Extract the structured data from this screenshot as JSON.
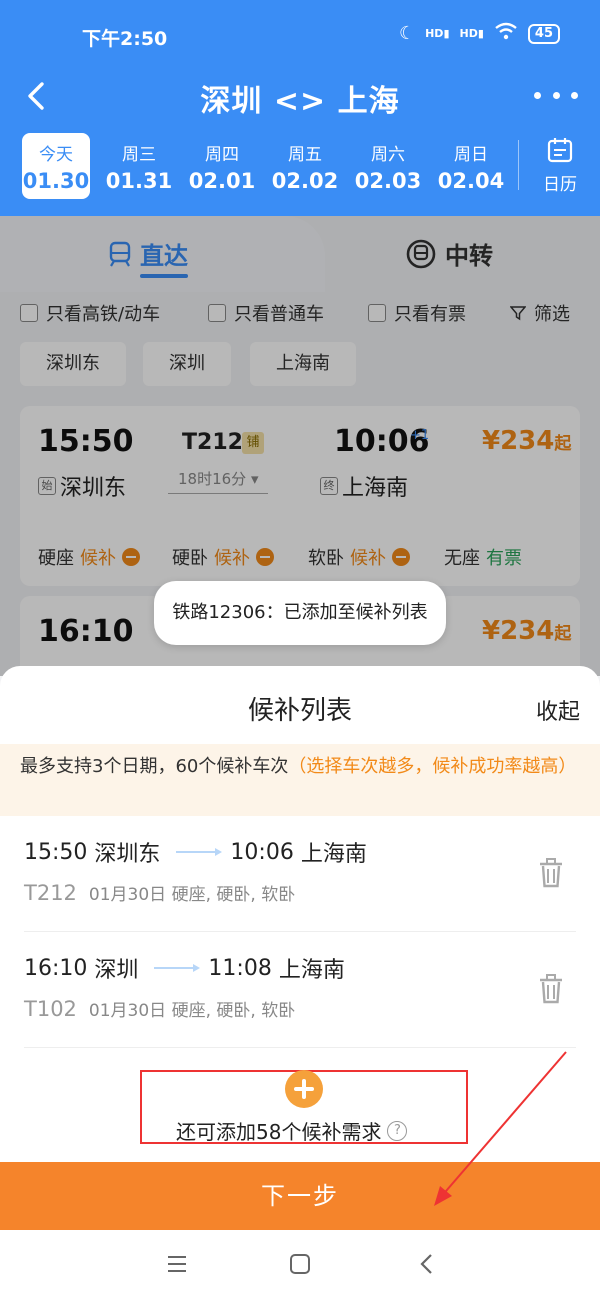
{
  "status_bar": {
    "time": "下午2:50",
    "signal1": "HD",
    "signal2": "HD",
    "battery": "45"
  },
  "header": {
    "title": "深圳 <> 上海"
  },
  "dates": [
    {
      "week": "今天",
      "date": "01.30",
      "active": true
    },
    {
      "week": "周三",
      "date": "01.31"
    },
    {
      "week": "周四",
      "date": "02.01"
    },
    {
      "week": "周五",
      "date": "02.02"
    },
    {
      "week": "周六",
      "date": "02.03"
    },
    {
      "week": "周日",
      "date": "02.04"
    }
  ],
  "calendar_label": "日历",
  "tabs": {
    "direct": "直达",
    "transfer": "中转"
  },
  "filters": {
    "gd": "只看高铁/动车",
    "normal": "只看普通车",
    "available": "只看有票",
    "screen": "筛选"
  },
  "stations": [
    "深圳东",
    "深圳",
    "上海南"
  ],
  "trains": [
    {
      "depart": "15:50",
      "depart_tag": "始",
      "from": "深圳东",
      "code": "T212",
      "badge": "铺",
      "duration": "18时16分 ▾",
      "arrive": "10:06",
      "plus_day": "+1",
      "arrive_tag": "终",
      "to": "上海南",
      "price": "¥234",
      "price_suffix": "起",
      "seats": [
        {
          "type": "硬座",
          "status": "候补"
        },
        {
          "type": "硬卧",
          "status": "候补"
        },
        {
          "type": "软卧",
          "status": "候补"
        },
        {
          "type": "无座",
          "status": "有票"
        }
      ]
    },
    {
      "depart": "16:10",
      "price": "¥234",
      "price_suffix": "起"
    }
  ],
  "toast": "铁路12306：已添加至候补列表",
  "sheet": {
    "title": "候补列表",
    "collapse": "收起",
    "notice_main": "最多支持3个日期，60个候补车次",
    "notice_highlight": "（选择车次越多，候补成功率越高）",
    "items": [
      {
        "depart": "15:50",
        "from": "深圳东",
        "arrive": "10:06",
        "to": "上海南",
        "code": "T212",
        "detail": "01月30日 硬座, 硬卧, 软卧"
      },
      {
        "depart": "16:10",
        "from": "深圳",
        "arrive": "11:08",
        "to": "上海南",
        "code": "T102",
        "detail": "01月30日 硬座, 硬卧, 软卧"
      }
    ],
    "add_text": "还可添加58个候补需求",
    "help": "?",
    "next": "下一步"
  },
  "colors": {
    "primary": "#3a8df5",
    "accent": "#f5842b",
    "highlight": "#e33333"
  }
}
